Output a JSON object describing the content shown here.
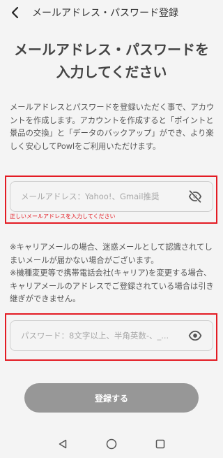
{
  "header": {
    "title": "メールアドレス・パスワード登録",
    "back_icon": "chevron-left-icon"
  },
  "heading": {
    "line1": "メールアドレス・パスワードを",
    "line2": "入力してください"
  },
  "description": "メールアドレスとパスワードを登録いただく事で、アカウントを作成します。アカウントを作成すると「ポイントと景品の交換」と「データのバックアップ」ができ、より楽しく安心してPowlをご利用いただけます。",
  "email_field": {
    "placeholder": "メールアドレス：Yahoo!、Gmail推奨",
    "value": "",
    "toggle_icon": "eye-off-icon",
    "error": "正しいメールアドレスを入力してください"
  },
  "notes": {
    "note1": "※キャリアメールの場合、迷惑メールとして認識されてしまいメールが届かない場合がございます。",
    "note2": "※機種変更等で携帯電話会社(キャリア)を変更する場合、キャリアメールのアドレスでご登録されている場合は引き継ぎができません。"
  },
  "password_field": {
    "placeholder": "パスワード：8文字以上、半角英数-、_...",
    "value": "",
    "toggle_icon": "eye-icon"
  },
  "submit": {
    "label": "登録する"
  },
  "nav": {
    "back_icon": "nav-back-icon",
    "home_icon": "nav-home-icon",
    "recents_icon": "nav-recents-icon"
  },
  "colors": {
    "background": "#f4f4f4",
    "highlight": "#e31b23",
    "error": "#e31b23",
    "button": "#979797"
  }
}
